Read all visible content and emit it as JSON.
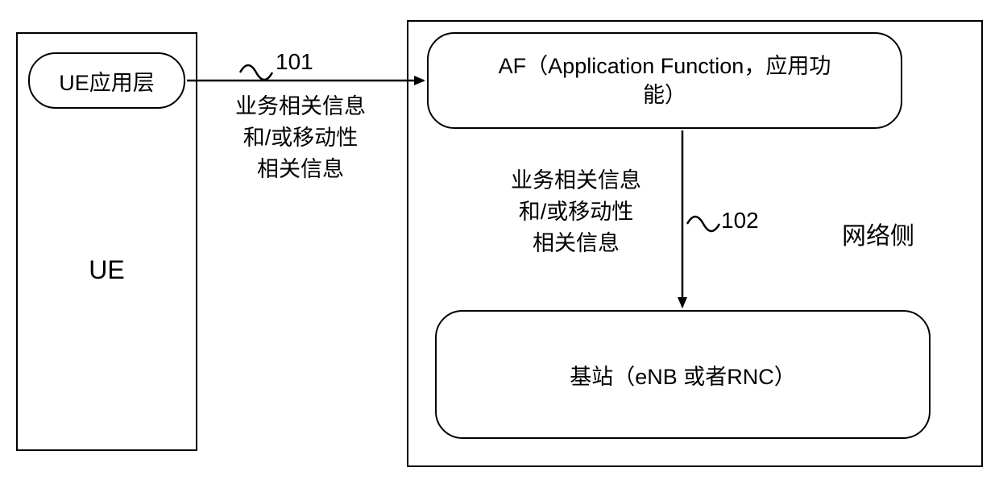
{
  "ue": {
    "app_layer_label": "UE应用层",
    "big_label": "UE"
  },
  "network": {
    "af_label_line1": "AF（Application Function，应用功",
    "af_label_line2": "能）",
    "bs_label": "基站（eNB 或者RNC）",
    "side_label": "网络侧"
  },
  "edges": {
    "e101": {
      "num": "101",
      "text_line1": "业务相关信息",
      "text_line2": "和/或移动性",
      "text_line3": "相关信息"
    },
    "e102": {
      "num": "102",
      "text_line1": "业务相关信息",
      "text_line2": "和/或移动性",
      "text_line3": "相关信息"
    }
  }
}
